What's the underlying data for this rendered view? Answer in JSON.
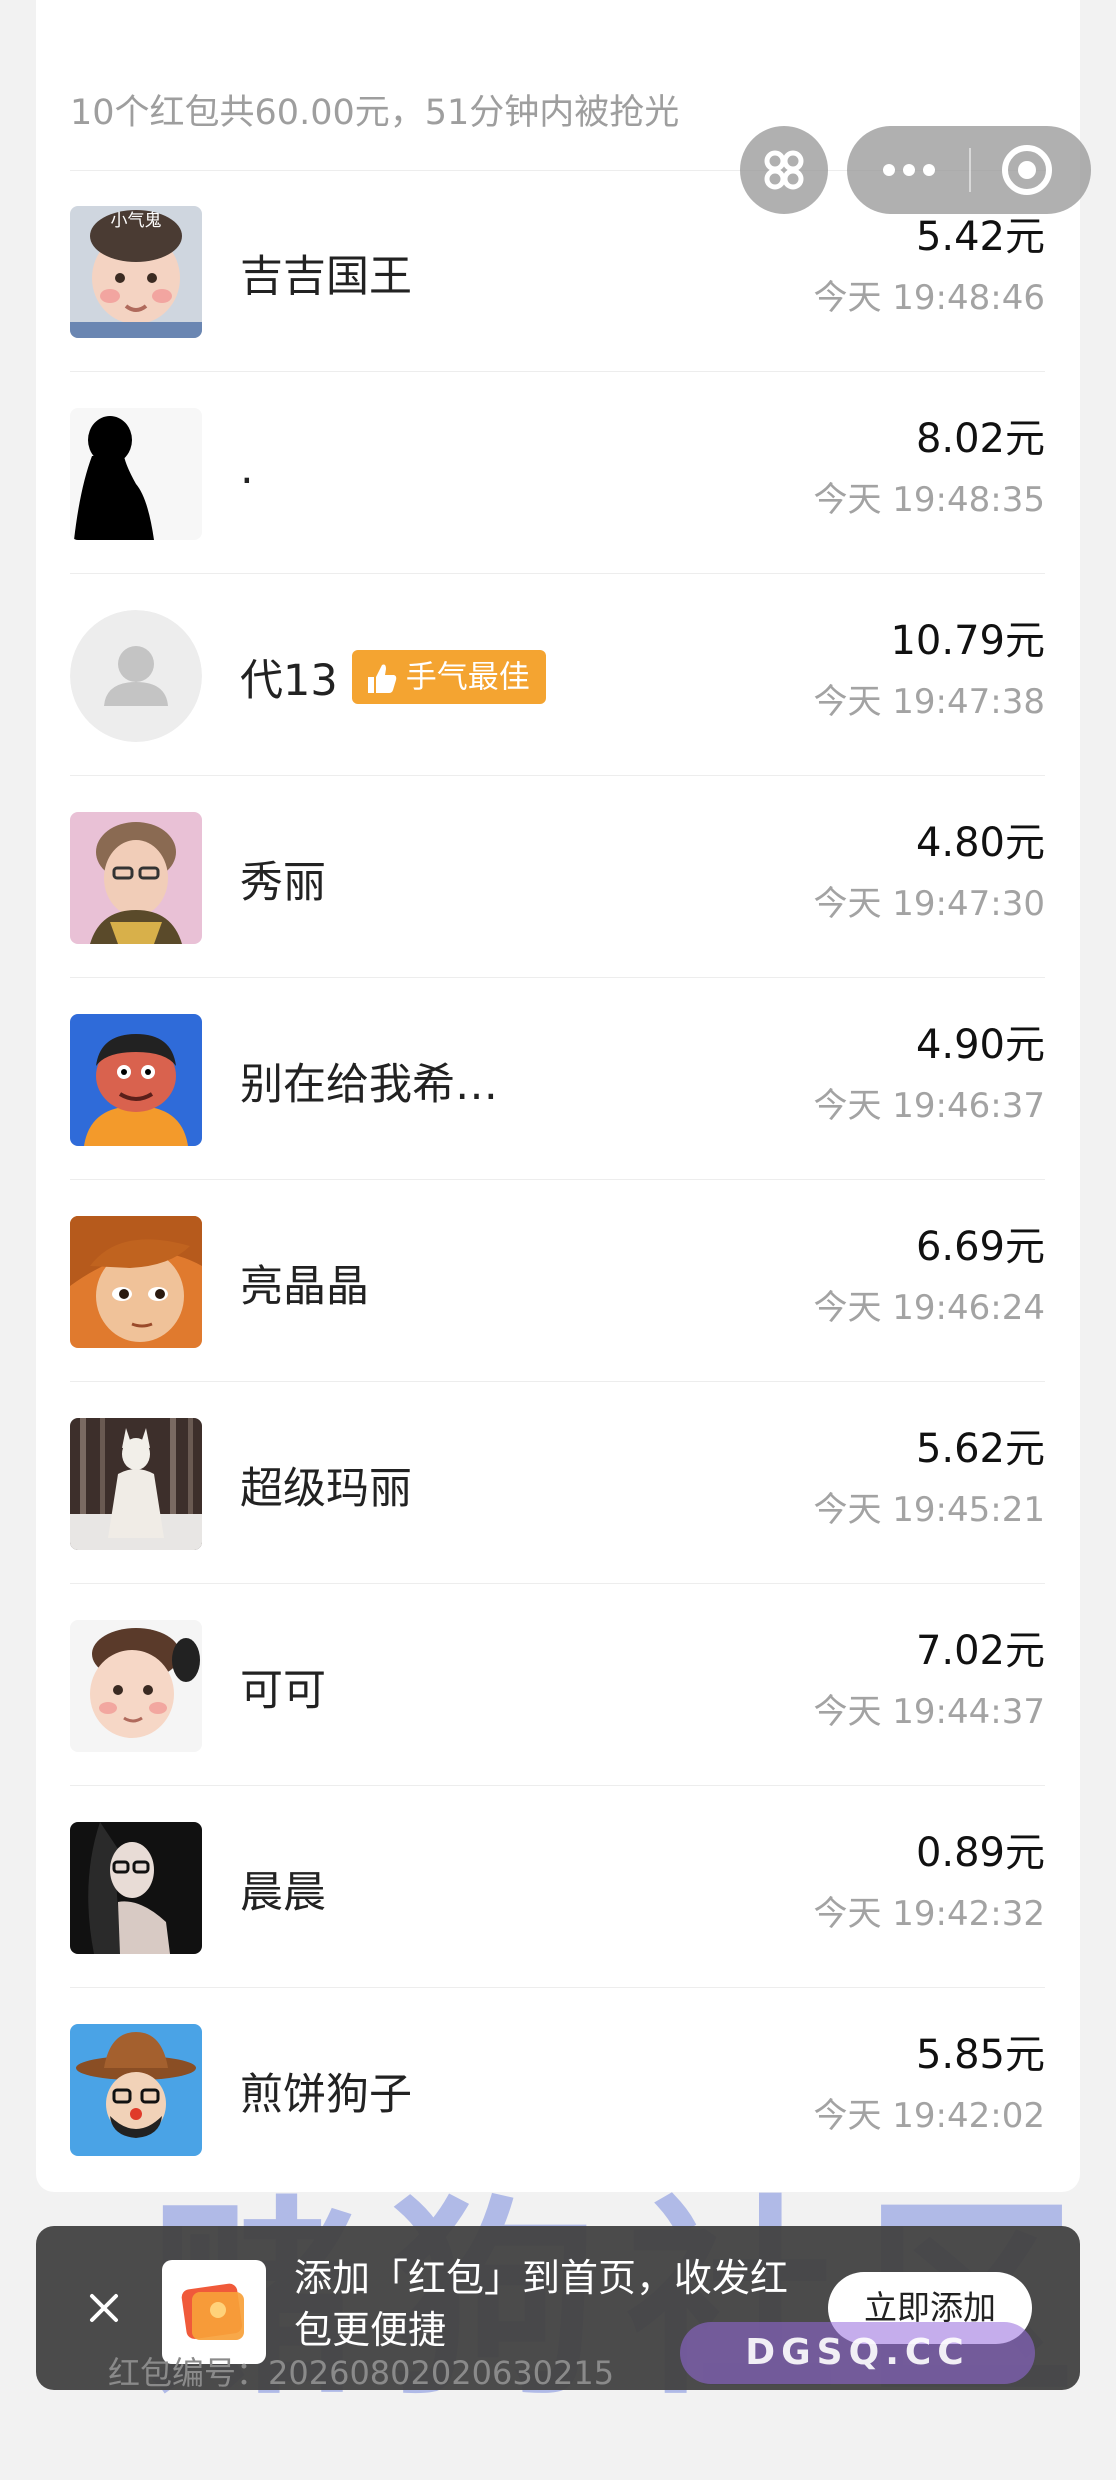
{
  "summary": {
    "text": "10个红包共60.00元，51分钟内被抢光"
  },
  "capsule": {
    "left_icon": "mini-program-grid-icon",
    "more_icon": "more-dots-icon",
    "close_icon": "close-target-icon"
  },
  "records": [
    {
      "name": "吉吉国王",
      "amount": "5.42元",
      "time": "今天 19:48:46",
      "avatar_label": "小气鬼"
    },
    {
      "name": ".",
      "amount": "8.02元",
      "time": "今天 19:48:35"
    },
    {
      "name": "代13",
      "amount": "10.79元",
      "time": "今天 19:47:38",
      "badge": "手气最佳"
    },
    {
      "name": "秀丽",
      "amount": "4.80元",
      "time": "今天 19:47:30"
    },
    {
      "name": "别在给我希…",
      "amount": "4.90元",
      "time": "今天 19:46:37"
    },
    {
      "name": "亮晶晶",
      "amount": "6.69元",
      "time": "今天 19:46:24"
    },
    {
      "name": "超级玛丽",
      "amount": "5.62元",
      "time": "今天 19:45:21"
    },
    {
      "name": "可可",
      "amount": "7.02元",
      "time": "今天 19:44:37"
    },
    {
      "name": "晨晨",
      "amount": "0.89元",
      "time": "今天 19:42:32"
    },
    {
      "name": "煎饼狗子",
      "amount": "5.85元",
      "time": "今天 19:42:02"
    }
  ],
  "footer_peek": {
    "text": "红包编号：20260802020630215"
  },
  "toast": {
    "text": "添加「红包」到首页，收发红包更便捷",
    "button_label": "立即添加",
    "close_icon": "close-icon"
  },
  "watermark": {
    "text": "赌狗社区",
    "url": "DGSQ.CC"
  },
  "colors": {
    "badge": "#f4a431",
    "toast_bg": "#444444",
    "watermark": "#697ddc"
  }
}
